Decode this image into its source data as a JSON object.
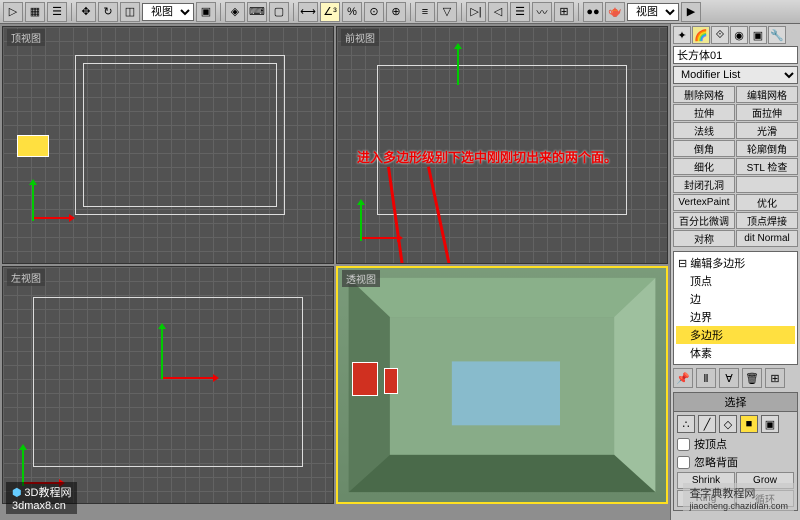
{
  "toolbar": {
    "view_dropdown": "视图",
    "view_dropdown2": "视图"
  },
  "viewports": {
    "top": "顶视图",
    "front": "前视图",
    "left": "左视图",
    "persp": "透视图"
  },
  "annotation": "进入多边形级别下选中刚刚切出来的两个面。",
  "panel": {
    "object_name": "长方体01",
    "modifier_list": "Modifier List",
    "buttons": {
      "delete_mesh": "删除网格",
      "edit_mesh": "编辑网格",
      "extrude": "拉伸",
      "face_extrude": "面拉伸",
      "normal": "法线",
      "smooth": "光滑",
      "chamfer": "倒角",
      "outline": "轮廓倒角",
      "tessellate": "细化",
      "stl": "STL 检查",
      "cap_holes": "封闭孔洞",
      "blank1": "",
      "vpaint": "VertexPaint",
      "optimize": "优化",
      "percent": "百分比微调",
      "weld": "顶点焊接",
      "symmetry": "对称",
      "editn": "dit Normal"
    },
    "stack": {
      "main": "编辑多边形",
      "vertex": "顶点",
      "edge": "边",
      "border": "边界",
      "polygon": "多边形",
      "element": "体素"
    },
    "rollout_select": "选择",
    "by_vertex": "按顶点",
    "ignore_back": "忽略背面",
    "shrink": "Shrink",
    "grow": "Grow",
    "ring": "Ring",
    "loop": "循环"
  },
  "watermarks": {
    "left": "3D教程网",
    "left_url": "3dmax8.cn",
    "right": "查字典教程网",
    "right_url": "jiaocheng.chazidian.com"
  }
}
